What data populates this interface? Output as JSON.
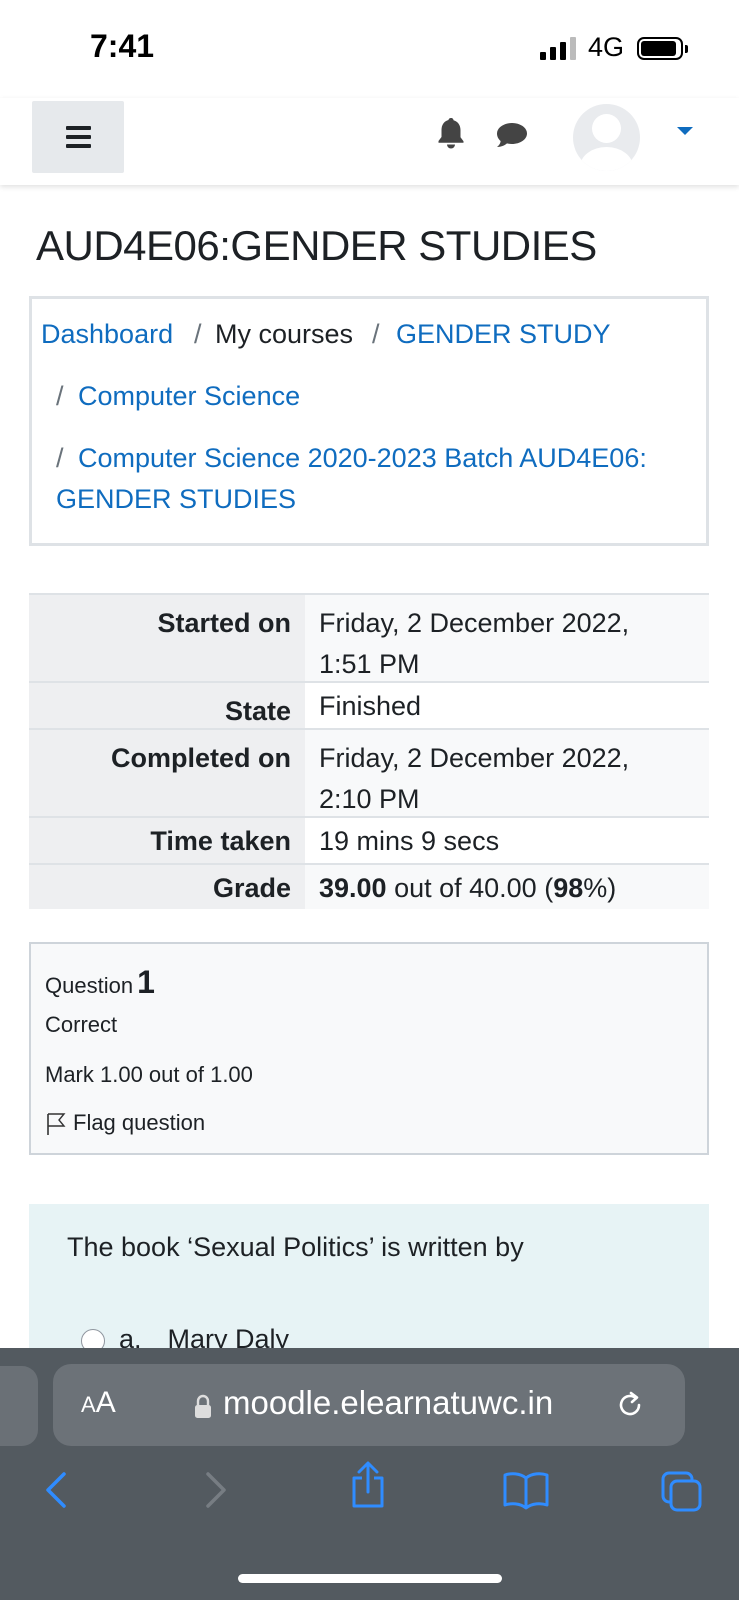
{
  "status_bar": {
    "time": "7:41",
    "network": "4G"
  },
  "navbar": {
    "menu_icon": "hamburger-icon",
    "notification_icon": "bell-icon",
    "message_icon": "chat-icon",
    "avatar_icon": "user-avatar",
    "menu_caret": "caret-down-icon"
  },
  "page": {
    "title": "AUD4E06:GENDER STUDIES"
  },
  "breadcrumb": {
    "dashboard": "Dashboard",
    "my_courses": "My courses",
    "gender_study": "GENDER STUDY",
    "computer_science": "Computer Science",
    "course_line1": "Computer Science 2020-2023 Batch AUD4E06:",
    "course_line2": "GENDER STUDIES",
    "separator": "/"
  },
  "summary": {
    "started_on_label": "Started on",
    "started_on_line1": "Friday, 2 December 2022,",
    "started_on_line2": "1:51 PM",
    "state_label": "State",
    "state_value": "Finished",
    "completed_on_label": "Completed on",
    "completed_on_line1": "Friday, 2 December 2022,",
    "completed_on_line2": "2:10 PM",
    "time_taken_label": "Time taken",
    "time_taken_value": "19 mins 9 secs",
    "grade_label": "Grade",
    "grade_score": "39.00",
    "grade_out_of": " out of 40.00 (",
    "grade_percent": "98",
    "grade_percent_suffix": "%)"
  },
  "question": {
    "label": "Question",
    "number": "1",
    "state": "Correct",
    "mark": "Mark 1.00 out of 1.00",
    "flag_label": "Flag question",
    "text": "The book ‘Sexual Politics’ is written by",
    "option_a_letter": "a.",
    "option_a_text": "Mary Daly"
  },
  "browser": {
    "aa_large": "A",
    "aa_small": "A",
    "url": "moodle.elearnatuwc.in",
    "toolbar_icons": [
      "back-icon",
      "forward-icon",
      "share-icon",
      "bookmarks-icon",
      "tabs-icon"
    ]
  }
}
